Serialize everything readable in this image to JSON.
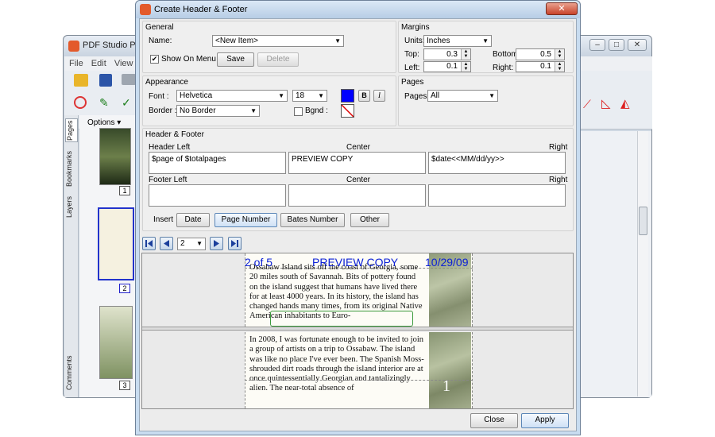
{
  "background_app": {
    "title": "PDF Studio Pro",
    "menu": [
      "File",
      "Edit",
      "View",
      "Se"
    ],
    "panel_options": "Options",
    "side_tabs": [
      "Pages",
      "Bookmarks",
      "Layers",
      "Comments"
    ],
    "thumbnail_numbers": [
      "1",
      "2",
      "3"
    ]
  },
  "dialog": {
    "title": "Create Header & Footer",
    "general": {
      "title": "General",
      "name_label": "Name:",
      "name_value": "<New Item>",
      "show_on_menu": "Show On Menu",
      "save": "Save",
      "delete": "Delete"
    },
    "margins": {
      "title": "Margins",
      "units_label": "Units:",
      "units_value": "Inches",
      "top_label": "Top:",
      "top_value": "0.3",
      "left_label": "Left:",
      "left_value": "0.1",
      "bottom_label": "Bottom:",
      "bottom_value": "0.5",
      "right_label": "Right:",
      "right_value": "0.1"
    },
    "appearance": {
      "title": "Appearance",
      "font_label": "Font :",
      "font_value": "Helvetica",
      "size_value": "18",
      "bold": "B",
      "italic": "I",
      "border_label": "Border :",
      "border_value": "No Border",
      "bgnd_label": "Bgnd :",
      "text_color": "#0000ff"
    },
    "pages": {
      "title": "Pages",
      "pages_label": "Pages :",
      "pages_value": "All"
    },
    "header_footer": {
      "title": "Header & Footer",
      "header_left_label": "Header Left",
      "center_label": "Center",
      "right_label": "Right",
      "header_left_value": "$page of $totalpages",
      "header_center_value": "PREVIEW COPY",
      "header_right_value": "$date<<MM/dd/yy>>",
      "footer_left_label": "Footer Left",
      "footer_left_value": "",
      "footer_center_value": "",
      "footer_right_value": "",
      "insert_label": "Insert",
      "insert_date": "Date",
      "insert_page_number": "Page Number",
      "insert_bates_number": "Bates Number",
      "insert_other": "Other"
    },
    "navigation": {
      "page_value": "2"
    },
    "preview": {
      "header_left": "2 of 5",
      "header_center": "PREVIEW COPY",
      "header_right": "10/29/09",
      "para1": "Ossabaw Island sits off the coast of Georgia, some 20 miles south of Savannah. Bits of pottery found on the island suggest that humans have lived there for at least 4000 years. In its history, the island has changed hands many times, from its original Native American inhabitants to Euro-",
      "para2": "In 2008, I was fortunate enough to be invited to join a group of artists on a trip to Ossabaw. The island was like no place I've ever been. The Spanish Moss-shrouded dirt roads through the island interior are at once quintessentially Georgian and tantalizingly alien. The near-total absence of",
      "page_number": "1"
    },
    "close": "Close",
    "apply": "Apply"
  }
}
